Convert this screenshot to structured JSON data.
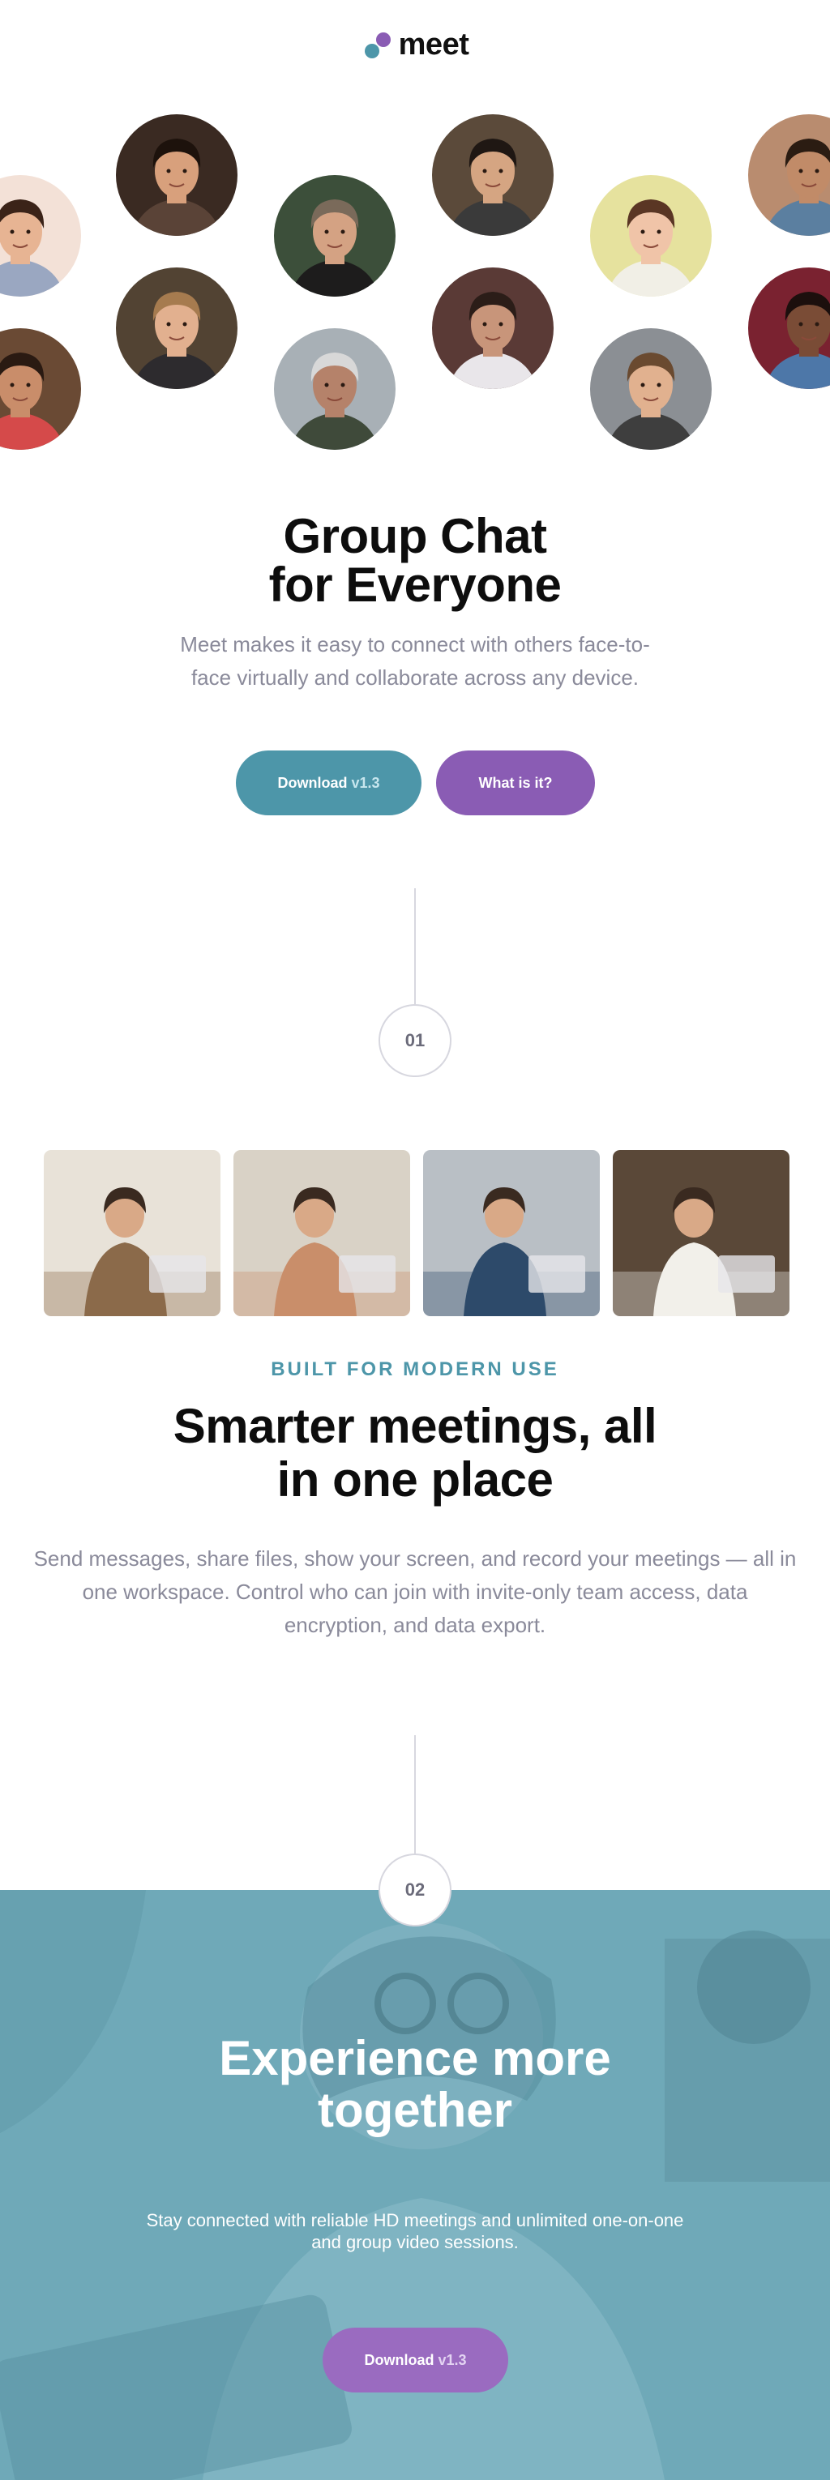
{
  "brand": {
    "name": "meet",
    "colors": {
      "teal": "#4d96a9",
      "purple": "#8a5cb4"
    }
  },
  "avatars": [
    {
      "name": "person-avatar",
      "skin": "#e7b493",
      "bg": "#f3e1d7",
      "hair": "#3b2318",
      "shirt": "#9aa7c1"
    },
    {
      "name": "person-avatar",
      "skin": "#c98d6a",
      "bg": "#6a4a34",
      "hair": "#2a1a12",
      "shirt": "#d54a4a"
    },
    {
      "name": "person-avatar",
      "skin": "#d8a07c",
      "bg": "#3a2a22",
      "hair": "#1d120c",
      "shirt": "#5a4337"
    },
    {
      "name": "person-avatar",
      "skin": "#e2b08f",
      "bg": "#524333",
      "hair": "#a67b4f",
      "shirt": "#2d2b2e"
    },
    {
      "name": "person-avatar",
      "skin": "#d4a283",
      "bg": "#3c4f3a",
      "hair": "#7a6a5a",
      "shirt": "#1d1c1c"
    },
    {
      "name": "person-avatar",
      "skin": "#b5826a",
      "bg": "#a8b0b6",
      "hair": "#d8d8d8",
      "shirt": "#3f4a3a"
    },
    {
      "name": "person-avatar",
      "skin": "#d5a582",
      "bg": "#5b4a3a",
      "hair": "#1f1713",
      "shirt": "#3a3a3a"
    },
    {
      "name": "person-avatar",
      "skin": "#c8957a",
      "bg": "#5a3a36",
      "hair": "#2b1d18",
      "shirt": "#e9e6ea"
    },
    {
      "name": "person-avatar",
      "skin": "#f0c4a8",
      "bg": "#e6e29e",
      "hair": "#5a3624",
      "shirt": "#f1efe6"
    },
    {
      "name": "person-avatar",
      "skin": "#e1b18f",
      "bg": "#8b8f94",
      "hair": "#6a4a30",
      "shirt": "#3e3e3e"
    },
    {
      "name": "person-avatar",
      "skin": "#c18b68",
      "bg": "#b98c6f",
      "hair": "#2b1c12",
      "shirt": "#5b7fa0"
    },
    {
      "name": "person-avatar",
      "skin": "#7a4c36",
      "bg": "#7a2230",
      "hair": "#1c0f0d",
      "shirt": "#4d77a8"
    }
  ],
  "hero": {
    "title_line1": "Group Chat",
    "title_line2": "for Everyone",
    "subtitle": "Meet makes it easy to connect with others face-to-face virtually and collaborate across any device.",
    "download_label": "Download",
    "download_version": "v1.3",
    "what_label": "What is it?"
  },
  "steps": {
    "one": "01",
    "two": "02"
  },
  "features": {
    "tiles": [
      {
        "name": "woman-laptop-photo",
        "bg": "#e8e2d8",
        "accent": "#8b6a4a"
      },
      {
        "name": "family-phone-photo",
        "bg": "#d9d2c6",
        "accent": "#c98e6a"
      },
      {
        "name": "video-call-tablet-photo",
        "bg": "#b9bfc5",
        "accent": "#2d4a6a"
      },
      {
        "name": "man-phone-photo",
        "bg": "#5a4838",
        "accent": "#f2f0ea"
      }
    ],
    "eyebrow": "BUILT FOR MODERN USE",
    "title_line1": "Smarter meetings, all",
    "title_line2": "in one place",
    "body": "Send messages, share files, show your screen, and record your meetings — all in one workspace. Control who can join with invite-only team access, data encryption, and data export."
  },
  "cta": {
    "title_line1": "Experience more",
    "title_line2": "together",
    "subtitle": "Stay connected with reliable HD meetings and unlimited one-on-one and group video sessions.",
    "download_label": "Download",
    "download_version": "v1.3"
  }
}
